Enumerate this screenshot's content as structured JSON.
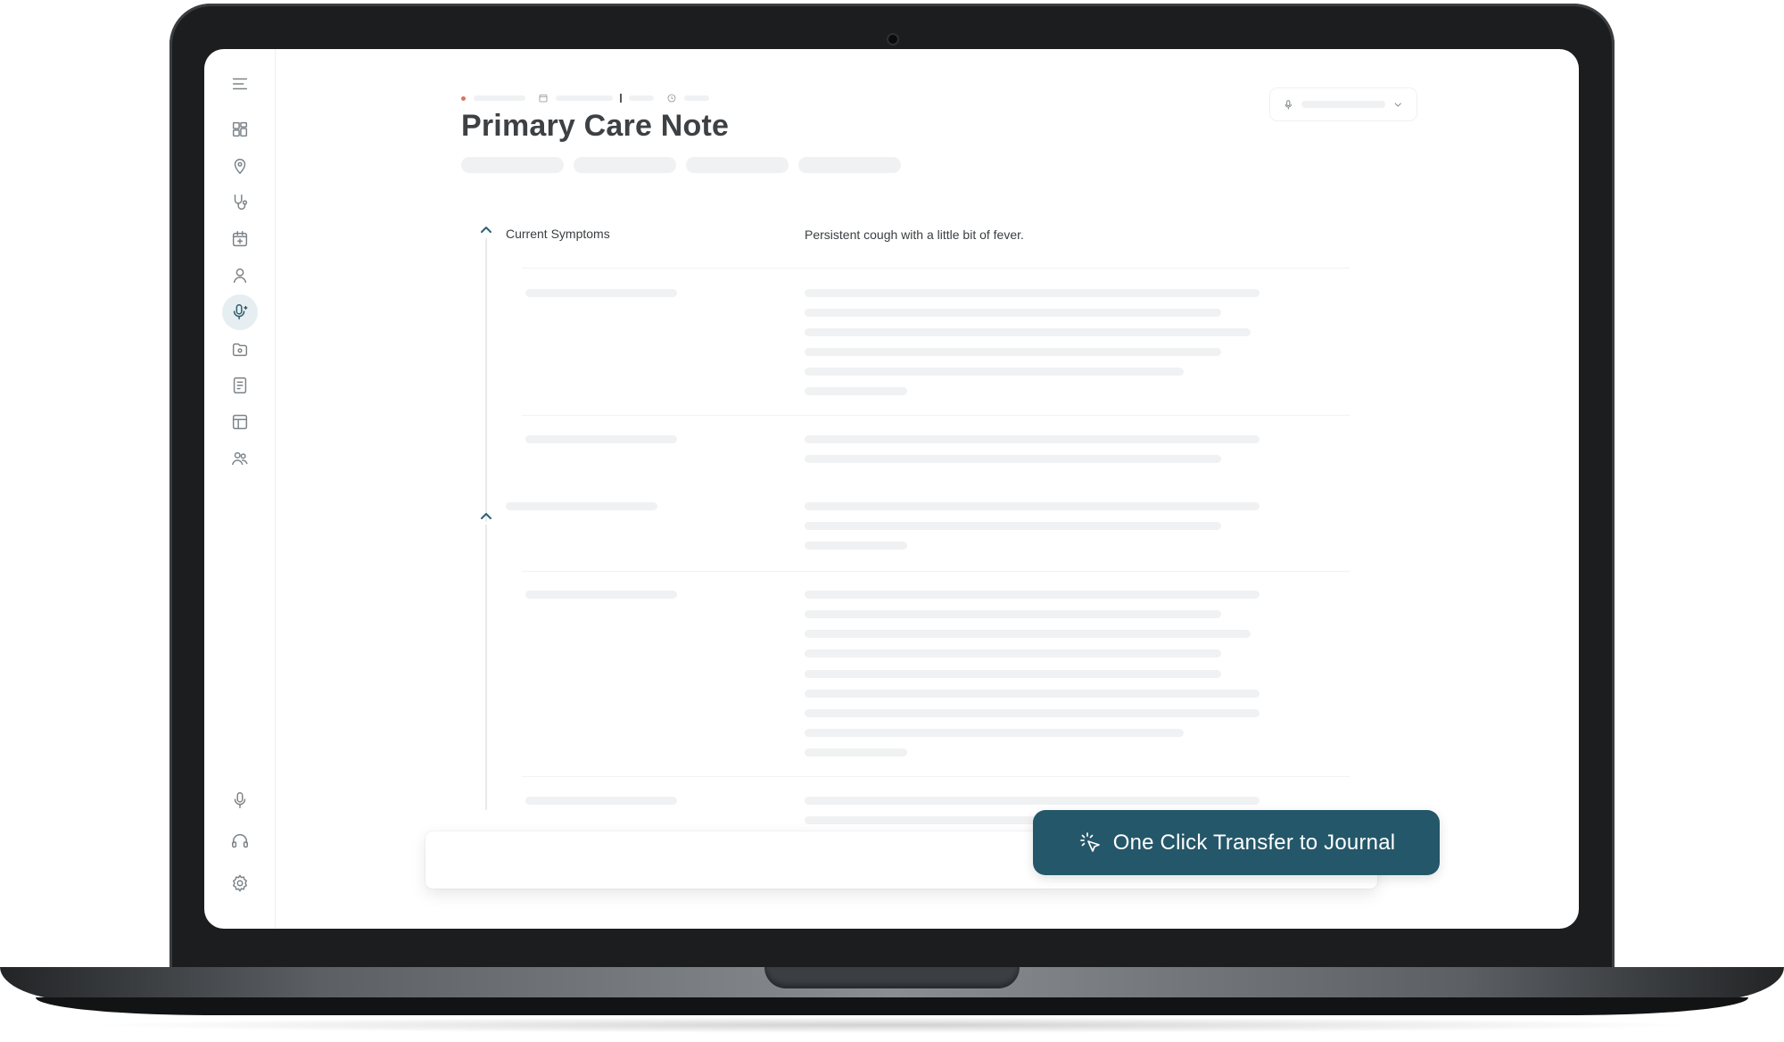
{
  "page": {
    "title": "Primary Care Note"
  },
  "sidebar": {
    "items": [
      {
        "icon": "menu-icon"
      },
      {
        "icon": "dashboard-icon"
      },
      {
        "icon": "location-pin-icon"
      },
      {
        "icon": "stethoscope-icon"
      },
      {
        "icon": "calendar-icon"
      },
      {
        "icon": "user-icon"
      },
      {
        "icon": "microphone-ai-icon",
        "active": true
      },
      {
        "icon": "folder-icon"
      },
      {
        "icon": "document-icon"
      },
      {
        "icon": "table-icon"
      },
      {
        "icon": "users-icon"
      }
    ],
    "bottom_items": [
      {
        "icon": "microphone-icon"
      },
      {
        "icon": "headset-icon"
      },
      {
        "icon": "settings-icon"
      }
    ]
  },
  "note": {
    "sections": [
      {
        "label": "Current Symptoms",
        "value": "Persistent cough with a little bit of fever."
      }
    ]
  },
  "cta": {
    "label": "One Click Transfer to Journal",
    "icon": "click-cursor-icon"
  },
  "colors": {
    "accent": "#245769",
    "active_nav_bg": "#e6eef1",
    "status_dot": "#e07060"
  }
}
